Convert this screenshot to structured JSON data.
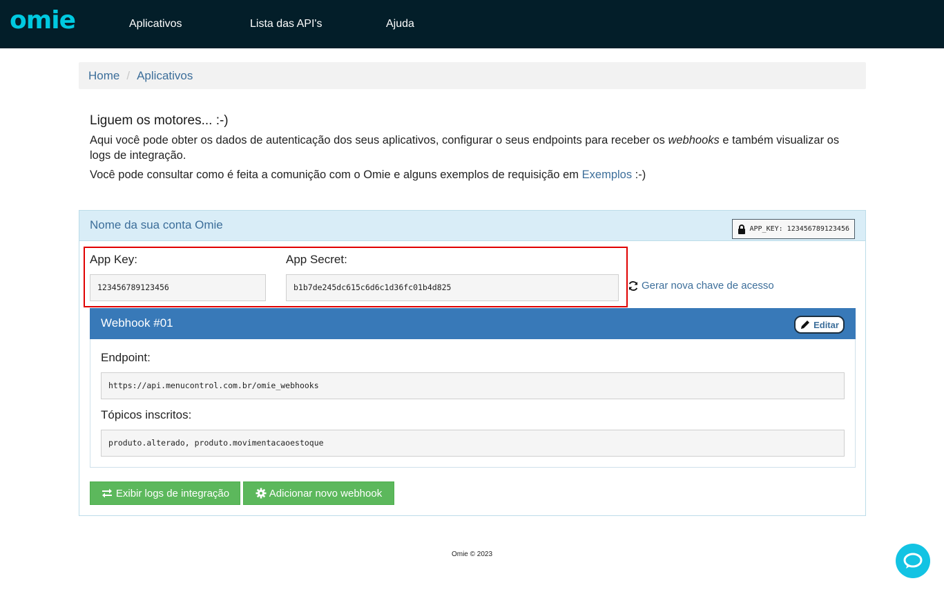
{
  "header": {
    "logo": "omie",
    "nav": [
      "Aplicativos",
      "Lista das API's",
      "Ajuda"
    ]
  },
  "breadcrumb": {
    "home": "Home",
    "current": "Aplicativos"
  },
  "intro": {
    "title": "Liguem os motores... :-)",
    "p1_before": "Aqui você pode obter os dados de autenticação dos seus aplicativos, configurar o seus endpoints para receber os ",
    "p1_em": "webhooks",
    "p1_after": " e também visualizar os logs de integração.",
    "p2_before": "Você pode consultar como é feita a comunição com o Omie e alguns exemplos de requisição em ",
    "p2_link": "Exemplos",
    "p2_after": " :-)"
  },
  "account": {
    "title": "Nome da sua conta Omie",
    "badge": "APP_KEY: 123456789123456",
    "app_key_label": "App Key:",
    "app_key_value": "123456789123456",
    "app_secret_label": "App Secret:",
    "app_secret_value": "b1b7de245dc615c6d6c1d36fc01b4d825",
    "regen_label": "Gerar nova chave de acesso"
  },
  "webhook": {
    "title": "Webhook #01",
    "edit_label": "Editar",
    "endpoint_label": "Endpoint:",
    "endpoint_value": "https://api.menucontrol.com.br/omie_webhooks",
    "topics_label": "Tópicos inscritos:",
    "topics_value": "produto.alterado, produto.movimentacaoestoque"
  },
  "actions": {
    "logs_label": "Exibir logs de integração",
    "add_label": "Adicionar novo webhook"
  },
  "footer": {
    "text": "Omie © 2023"
  },
  "colors": {
    "topbar": "#031e29",
    "brand": "#00c9e0",
    "link": "#3c6e9a",
    "panel_head": "#d9edf7",
    "webhook_head": "#3879b8",
    "success": "#5cb85c",
    "highlight": "#e00000"
  }
}
